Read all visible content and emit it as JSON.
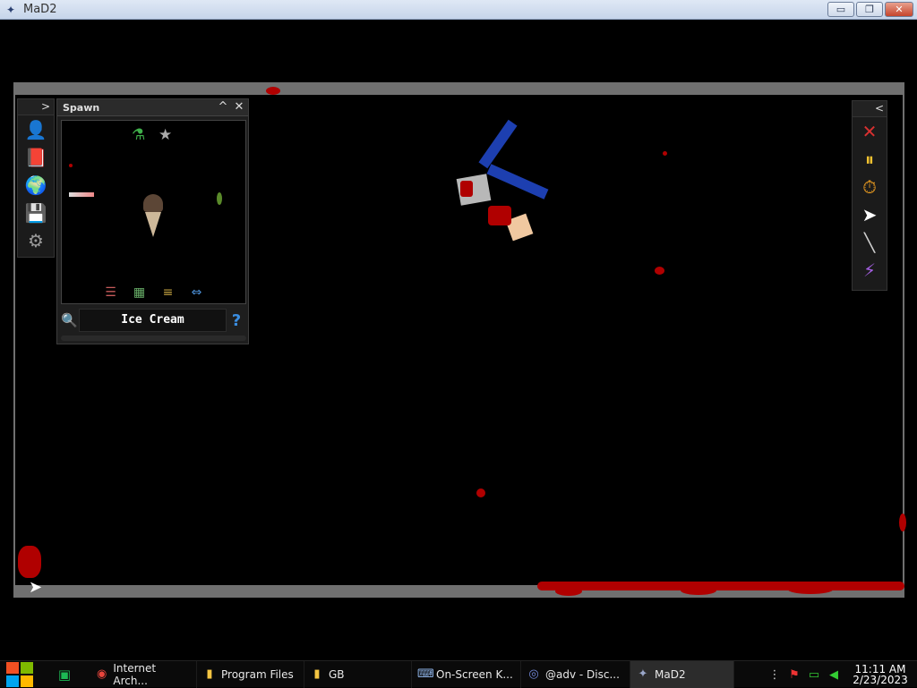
{
  "window": {
    "title": "MaD2",
    "minimize_label": "▭",
    "restore_label": "❐",
    "close_label": "✕"
  },
  "left_toolbar": {
    "toggle_label": ">",
    "tools": [
      {
        "name": "ragdoll-tool",
        "icon": "👤"
      },
      {
        "name": "catalog-book",
        "icon": "📕"
      },
      {
        "name": "world",
        "icon": "🌍"
      },
      {
        "name": "save",
        "icon": "💾"
      },
      {
        "name": "settings",
        "icon": "⚙"
      }
    ]
  },
  "spawn_panel": {
    "title": "Spawn",
    "collapse_label": "^",
    "close_label": "✕",
    "category_icons": [
      "flask-icon",
      "star-icon"
    ],
    "search_value": "Ice Cream",
    "help_label": "?"
  },
  "right_toolbar": {
    "toggle_label": "<",
    "tools": [
      {
        "name": "delete-tool",
        "icon": "✕",
        "color": "#d83030"
      },
      {
        "name": "pause-tool",
        "icon": "⏸",
        "color": "#f2c230"
      },
      {
        "name": "slow-motion-tool",
        "icon": "⏱",
        "color": "#f2a020"
      },
      {
        "name": "cursor-tool",
        "icon": "➤",
        "color": "#ffffff"
      },
      {
        "name": "knife-tool",
        "icon": "╲",
        "color": "#d0d0d0"
      },
      {
        "name": "lightning-tool",
        "icon": "⚡",
        "color": "#a35ee0"
      }
    ]
  },
  "taskbar": {
    "items": [
      {
        "label": "Internet Arch...",
        "icon": "◉",
        "color": "#e8453c"
      },
      {
        "label": "Program Files",
        "icon": "▮",
        "color": "#f4c542"
      },
      {
        "label": "GB",
        "icon": "▮",
        "color": "#f4c542"
      },
      {
        "label": "On-Screen K...",
        "icon": "⌨",
        "color": "#8fb4e8"
      },
      {
        "label": "@adv - Disc...",
        "icon": "◎",
        "color": "#7289da"
      },
      {
        "label": "MaD2",
        "icon": "✦",
        "color": "#9aa7c9"
      }
    ],
    "time": "11:11 AM",
    "date": "2/23/2023"
  }
}
